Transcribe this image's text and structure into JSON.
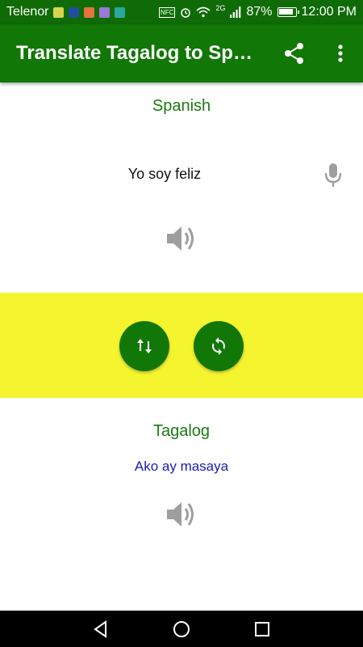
{
  "status_bar": {
    "carrier": "Telenor",
    "nfc": "NFC",
    "network": "2G",
    "battery": "87%",
    "battery_level": 0.87,
    "time": "12:00 PM"
  },
  "toolbar": {
    "title": "Translate Tagalog to Spa..."
  },
  "source": {
    "language": "Spanish",
    "text": "Yo soy feliz"
  },
  "target": {
    "language": "Tagalog",
    "text": "Ako ay masaya"
  },
  "colors": {
    "primary": "#117707",
    "status_bar": "#0f6b06",
    "accent_band": "#f4f42f",
    "language_label": "#1a7a12",
    "translated_text": "#1b1bb0",
    "icon_gray": "#9e9e9e"
  },
  "icons": {
    "share": "share-icon",
    "more": "more-vert-icon",
    "mic": "mic-icon",
    "speaker": "volume-up-icon",
    "swap": "swap-vert-icon",
    "refresh": "sync-icon"
  }
}
